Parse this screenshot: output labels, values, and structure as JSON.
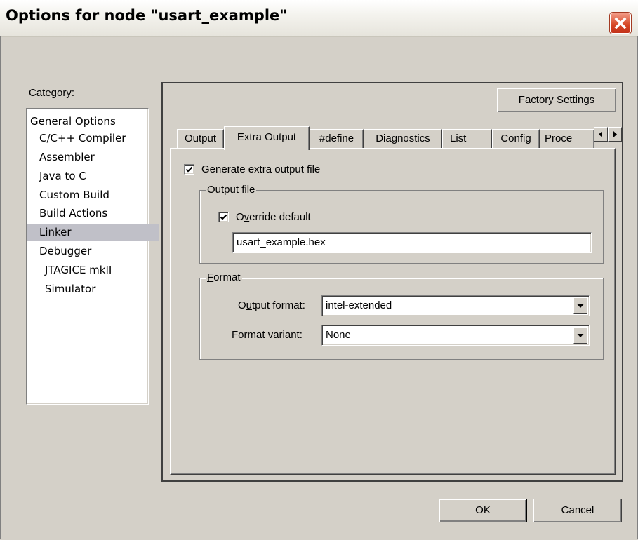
{
  "window": {
    "title": "Options for node \"usart_example\""
  },
  "category": {
    "label": "Category:",
    "items": [
      "General Options",
      "C/C++ Compiler",
      "Assembler",
      "Java to C",
      "Custom Build",
      "Build Actions",
      "Linker",
      "Debugger",
      "JTAGICE mkII",
      "Simulator"
    ],
    "selected": "Linker"
  },
  "buttons": {
    "factory_settings": "Factory Settings",
    "ok": "OK",
    "cancel": "Cancel"
  },
  "tabs": [
    "Output",
    "Extra Output",
    "#define",
    "Diagnostics",
    "List",
    "Config",
    "Proce"
  ],
  "active_tab": "Extra Output",
  "extra_output": {
    "generate_label": "Generate extra output file",
    "generate_checked": true,
    "output_file": {
      "group_label_u": "O",
      "group_label_rest": "utput file",
      "override_pre": "O",
      "override_u": "v",
      "override_rest": "erride default",
      "override_checked": true,
      "filename": "usart_example.hex"
    },
    "format": {
      "group_label_u": "F",
      "group_label_rest": "ormat",
      "output_format_pre": "O",
      "output_format_u": "u",
      "output_format_rest": "tput format:",
      "output_format_value": "intel-extended",
      "variant_pre": "Fo",
      "variant_u": "r",
      "variant_rest": "mat variant:",
      "variant_value": "None"
    }
  },
  "icons": {
    "close": "close-icon",
    "scroll_left": "arrow-left-icon",
    "scroll_right": "arrow-right-icon",
    "dropdown": "chevron-down-icon",
    "check": "check-icon"
  }
}
